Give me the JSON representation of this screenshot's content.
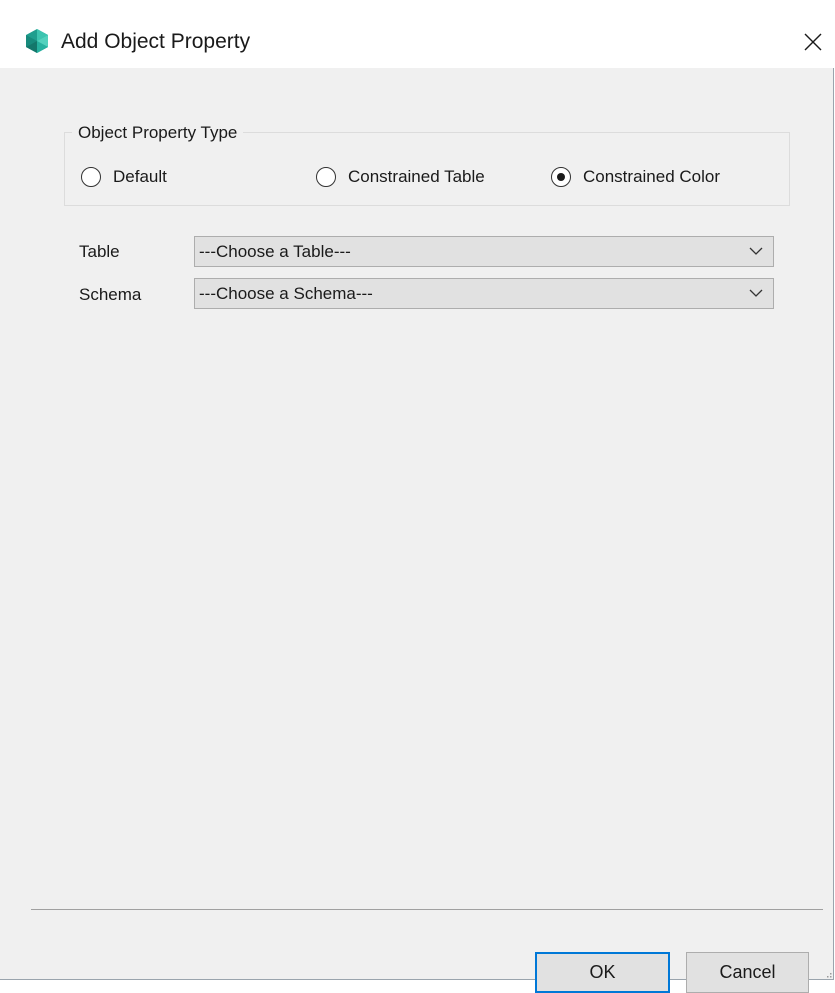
{
  "window": {
    "title": "Add Object Property",
    "icon": "app-logo-icon",
    "close_icon": "close-icon"
  },
  "property_type": {
    "legend": "Object Property Type",
    "options": [
      {
        "label": "Default",
        "selected": false
      },
      {
        "label": "Constrained Table",
        "selected": false
      },
      {
        "label": "Constrained Color",
        "selected": true
      }
    ]
  },
  "fields": {
    "table": {
      "label": "Table",
      "value": "---Choose a Table---"
    },
    "schema": {
      "label": "Schema",
      "value": "---Choose a Schema---"
    }
  },
  "buttons": {
    "ok": "OK",
    "cancel": "Cancel"
  },
  "colors": {
    "accent": "#0078d7",
    "icon_teal": "#2aa79b",
    "dialog_bg": "#f0f0f0",
    "titlebar_bg": "#ffffff"
  }
}
